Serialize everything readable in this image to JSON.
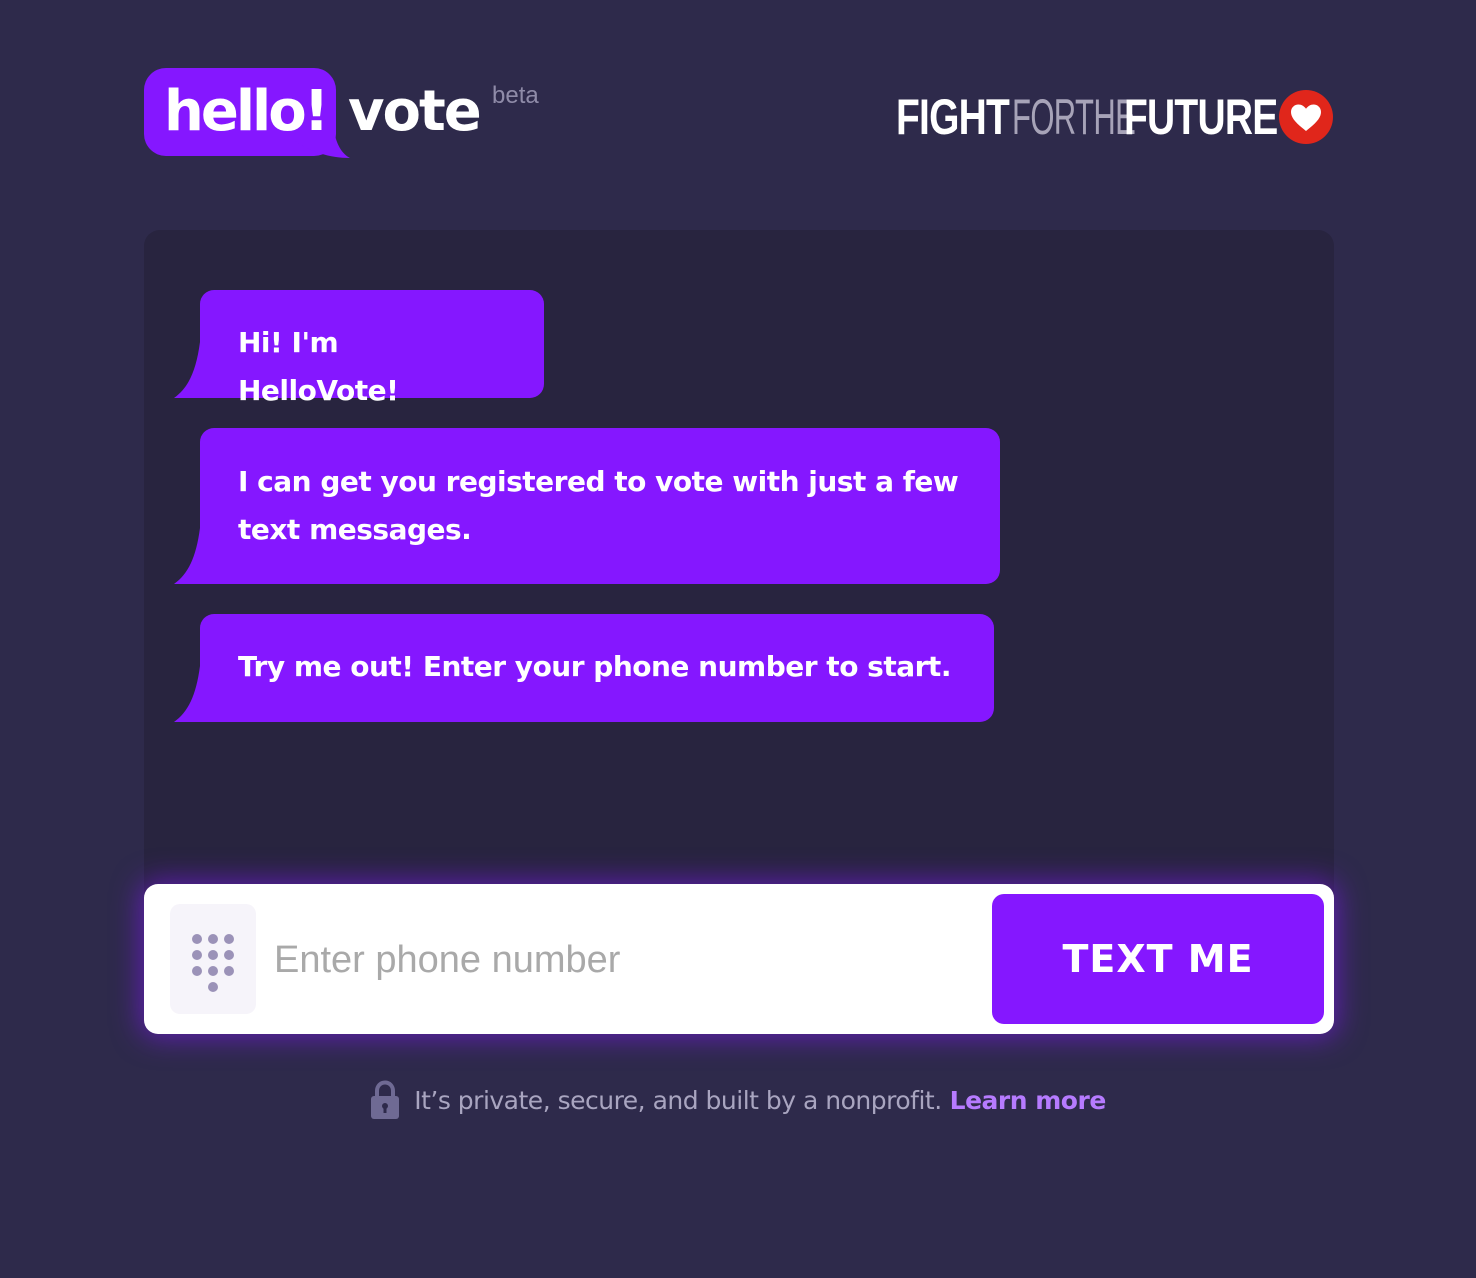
{
  "header": {
    "logo": {
      "hello_text": "hello!",
      "vote_text": "vote",
      "beta_label": "beta"
    },
    "partner_logo": {
      "word1": "FIGHT",
      "word2": "FORTHE",
      "word3": "FUTURE",
      "icon": "heart-icon"
    }
  },
  "chat": {
    "messages": [
      {
        "text": "Hi! I'm HelloVote!"
      },
      {
        "text": "I can get you registered to vote with just a few text messages."
      },
      {
        "text": "Try me out! Enter your phone number to start."
      }
    ]
  },
  "signup": {
    "keypad_icon": "keypad-icon",
    "phone_placeholder": "Enter phone number",
    "phone_value": "",
    "submit_label": "TEXT ME"
  },
  "footer": {
    "lock_icon": "lock-icon",
    "privacy_text": "It’s private, secure, and built by a nonprofit.",
    "learn_more_label": "Learn more"
  },
  "colors": {
    "background": "#2e2a4b",
    "panel": "#28243f",
    "accent": "#8517ff",
    "link": "#b67bff",
    "heart": "#e0261b"
  }
}
